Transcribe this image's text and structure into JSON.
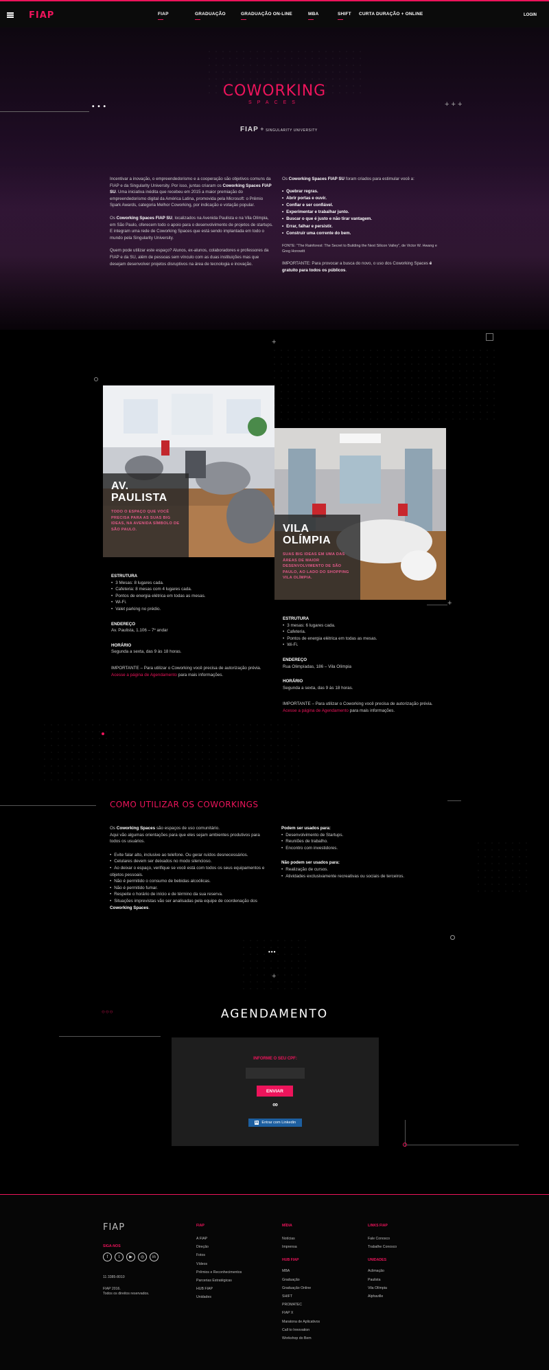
{
  "nav": {
    "logo": "FIAP",
    "items": [
      "FIAP",
      "GRADUAÇÃO",
      "GRADUAÇÃO ON-LINE",
      "MBA",
      "SHIFT",
      "CURTA DURAÇÃO + ONLINE"
    ],
    "login": "LOGIN"
  },
  "hero": {
    "title": "COWORKING",
    "subtitle": "SPACES",
    "partner_left": "FIAP",
    "partner_plus": "+",
    "partner_right": "SINGULARITY UNIVERSITY",
    "intro": [
      [
        "Incentivar a inovação, o empreendedorismo e a cooperação são objetivos comuns da FIAP e da Singularity University. Por isso, juntas criaram os ",
        "Coworking Spaces FIAP SU",
        ". Uma iniciativa inédita que recebeu em 2015 a maior premiação do empreendedorismo digital da América Latina, promovida pela Microsoft: o Prêmio Spark Awards, categoria Melhor Coworking, por indicação e votação popular."
      ],
      [
        "Os ",
        "Coworking Spaces FIAP SU",
        ", localizados na Avenida Paulista e na Vila Olímpia, em São Paulo, oferecem todo o apoio para o desenvolvimento de projetos de startups. E integram uma rede de Coworking Spaces que está sendo implantada em todo o mundo pela Singularity University."
      ],
      [
        "Quem pode utilizar este espaço? Alunos, ex-alunos, colaboradores e professores da FIAP e da SU, além de pessoas sem vínculo com as duas instituições mas que desejam desenvolver projetos disruptivos na área de tecnologia e inovação.",
        "",
        ""
      ]
    ],
    "principles_intro_1": "Os ",
    "principles_intro_bold": "Coworking Spaces FIAP SU",
    "principles_intro_2": " foram criados para estimular você a:",
    "principles": [
      "Quebrar regras.",
      "Abrir portas e ouvir.",
      "Confiar e ser confiável.",
      "Experimentar e trabalhar junto.",
      "Buscar o que é justo e não tirar vantagem.",
      "Errar, falhar e persistir.",
      "Construir uma corrente do bem."
    ],
    "source": "FONTE: \"The Rainforest: The Secret to Building the Next Silicon Valley\", de Victor W. Hwang e Greg Horowitt",
    "important_1": "IMPORTANTE: Para provocar a busca do novo, o uso dos Coworking Spaces ",
    "important_bold": "é gratuito para todos os públicos",
    "important_2": "."
  },
  "units": [
    {
      "name_1": "AV.",
      "name_2": "PAULISTA",
      "desc": "TODO O ESPAÇO QUE VOCÊ PRECISA PARA AS SUAS BIG IDEAS, NA AVENIDA SÍMBOLO DE SÃO PAULO.",
      "structure_title": "ESTRUTURA",
      "structure": [
        "3 Mesas: 8 lugares cada.",
        "Cafeteria: 8 mesas com 4 lugares cada.",
        "Pontos de energia elétrica em todas as mesas.",
        "Wi-Fi.",
        "Valet parking no prédio."
      ],
      "address_title": "ENDEREÇO",
      "address": "Av. Paulista, 1.106 – 7º andar",
      "hours_title": "HORÁRIO",
      "hours": "Segunda a sexta, das 9 às 18 horas.",
      "note_1": "IMPORTANTE – Para utilizar o Coworking você precisa de autorização prévia. ",
      "note_link": "Acesse a página de Agendamento",
      "note_2": " para mais informações."
    },
    {
      "name_1": "VILA",
      "name_2": "OLÍMPIA",
      "desc": "SUAS BIG IDEAS EM UMA DAS ÁREAS DE MAIOR DESENVOLVIMENTO DE SÃO PAULO, AO LADO DO SHOPPING VILA OLÍMPIA.",
      "structure_title": "ESTRUTURA",
      "structure": [
        "3 mesas: 6 lugares cada.",
        "Cafeteria.",
        "Pontos de energia elétrica em todas as mesas.",
        "Wi-Fi."
      ],
      "address_title": "ENDEREÇO",
      "address": "Rua Olimpíadas, 186 – Vila Olímpia",
      "hours_title": "HORÁRIO",
      "hours": "Segunda a sexta, das 9 às 18 horas.",
      "note_1": "IMPORTANTE – Para utilizar o Coworking você precisa de autorização prévia. ",
      "note_link": "Acesse a página de Agendamento",
      "note_2": " para mais informações."
    }
  ],
  "howto": {
    "title": "COMO UTILIZAR OS COWORKINGS",
    "intro_1": "Os ",
    "intro_bold": "Coworking Spaces",
    "intro_2": " são espaços de uso comunitário.",
    "intro_3": "Aqui vão algumas orientações para que eles sejam ambientes produtivos para todos os usuários.",
    "rules": [
      "Evite falar alto, inclusive ao telefone. Ou gerar ruídos desnecessários.",
      "Celulares devem ser deixados no modo silencioso.",
      "Ao deixar o espaço, verifique se você está com todos os seus equipamentos e objetos pessoais.",
      "Não é permitido o consumo de bebidas alcoólicas.",
      "Não é permitido fumar.",
      "Respeite o horário de início e de término da sua reserva."
    ],
    "last_rule_1": "Situações imprevistas vão ser analisadas pela equipe de coordenação dos ",
    "last_rule_bold": "Coworking Spaces",
    "last_rule_2": ".",
    "can_title": "Podem ser usados para:",
    "can": [
      "Desenvolvimento de Startups.",
      "Reuniões de trabalho.",
      "Encontro com investidores."
    ],
    "cannot_title": "Não podem ser usados para:",
    "cannot": [
      "Realização de cursos.",
      "Atividades exclusivamente recreativas ou sociais de terceiros."
    ]
  },
  "agenda": {
    "title": "AGENDAMENTO",
    "cpf_label": "INFORME O SEU CPF:",
    "send": "ENVIAR",
    "infinity": "∞",
    "linkedin_badge": "in",
    "linkedin": "Entrar com Linkedin"
  },
  "footer": {
    "logo": "FIAP",
    "social_title": "SIGA-NOS",
    "social": [
      "f",
      "t",
      "▶",
      "◎",
      "in"
    ],
    "phone": "11 3385-8010",
    "copyright_1": "FIAP 2016.",
    "copyright_2": "Todos os direitos reservados.",
    "columns": [
      {
        "title": "FIAP",
        "links": [
          "A FIAP",
          "Direção",
          "Fotos",
          "Vídeos",
          "Prêmios e Reconhecimentos",
          "Parcerias Estratégicas",
          "HUB FIAP",
          "Unidades"
        ]
      },
      {
        "title": "MÍDIA",
        "links": [
          "Notícias",
          "Imprensa"
        ],
        "title2": "HUB FIAP",
        "links2": [
          "MBA",
          "Graduação",
          "Graduação Online",
          "SHIFT",
          "PROMATEC",
          "FIAP X",
          "Maratona de Aplicativos",
          "Call to Innovation",
          "Workshop do Bem"
        ]
      },
      {
        "title": "LINKS FIAP",
        "links": [
          "Fale Conosco",
          "Trabalhe Conosco"
        ],
        "title2": "UNIDADES",
        "links2": [
          "Aclimação",
          "Paulista",
          "Vila Olímpia",
          "Alphaville"
        ]
      }
    ]
  },
  "colors": {
    "accent": "#ed145b",
    "background": "#000000",
    "panel": "#1e1e1e",
    "linkedin": "#1d5fa0"
  }
}
